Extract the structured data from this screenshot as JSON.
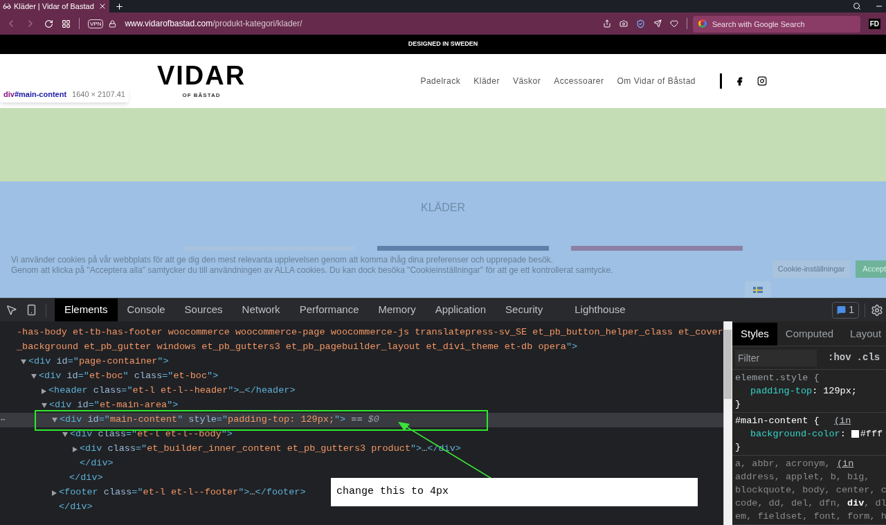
{
  "browser": {
    "tab_title": "Kläder | Vidar of Bastad",
    "vpn_badge": "VPN",
    "url_host": "www.vidarofbastad.com",
    "url_path": "/produkt-kategori/klader/",
    "search": {
      "placeholder": "Search with Google Search"
    },
    "profile": "FD"
  },
  "site": {
    "banner": "DESIGNED IN SWEDEN",
    "logo": "VIDAR",
    "logo_sub": "OF BÅSTAD",
    "nav": [
      {
        "label": "Padelrack"
      },
      {
        "label": "Kläder"
      },
      {
        "label": "Väskor"
      },
      {
        "label": "Accessoarer"
      },
      {
        "label": "Om Vidar of Båstad"
      }
    ],
    "heading": "KLÄDER",
    "card_edges": [
      {
        "color": "#a8c3df"
      },
      {
        "color": "#5e80aa"
      },
      {
        "color": "#8d80a3"
      }
    ],
    "cookie": {
      "text": [
        "Vi använder cookies på vår webbplats för att ge dig den mest relevanta upplevelsen genom att komma ihåg dina preferenser och upprepade besök.",
        "Genom att klicka på \"Acceptera alla\" samtycker du till användningen av ALLA cookies. Du kan dock besöka \"Cookieinställningar\" för att ge ett kontrollerat samtycke."
      ],
      "buttons": [
        {
          "label": "Cookie-inställningar",
          "kind": "secondary"
        },
        {
          "label": "Accept",
          "kind": "primary"
        }
      ]
    }
  },
  "inspect_tooltip": {
    "selector_tag": "div",
    "selector_id": "#main-content",
    "size": "1640 × 2107.41"
  },
  "devtools": {
    "tabs": [
      {
        "label": "Elements",
        "selected": true
      },
      {
        "label": "Console",
        "selected": false
      },
      {
        "label": "Sources",
        "selected": false
      },
      {
        "label": "Network",
        "selected": false
      },
      {
        "label": "Performance",
        "selected": false
      },
      {
        "label": "Memory",
        "selected": false
      },
      {
        "label": "Application",
        "selected": false
      },
      {
        "label": "Security",
        "selected": false
      },
      {
        "label": "Lighthouse",
        "selected": false
      }
    ],
    "issues_count": "1",
    "row_menu": "⋯",
    "dom": [
      {
        "selected": false,
        "tokens": [
          {
            "kind": "val",
            "s": "-has-body et-tb-has-footer woocommerce woocommerce-page woocommerce-js translatepress-sv_SE et_pb_button_helper_class et_cover"
          }
        ]
      },
      {
        "selected": false,
        "tokens": [
          {
            "kind": "val",
            "s": "_background et_pb_gutter windows et_pb_gutters3 et_pb_pagebuilder_layout et_divi_theme et-db opera"
          },
          {
            "kind": "tag",
            "s": "\">"
          }
        ]
      },
      {
        "expanded": true,
        "selected": false,
        "tokens": [
          {
            "kind": "tag",
            "s": "<div"
          },
          {
            "kind": "attr",
            "s": " id"
          },
          {
            "kind": "tag",
            "s": "=\""
          },
          {
            "kind": "val",
            "s": "page-container"
          },
          {
            "kind": "tag",
            "s": "\">"
          }
        ],
        "children": [
          {
            "expanded": true,
            "selected": false,
            "tokens": [
              {
                "kind": "tag",
                "s": "<div"
              },
              {
                "kind": "attr",
                "s": " id"
              },
              {
                "kind": "tag",
                "s": "=\""
              },
              {
                "kind": "val",
                "s": "et-boc"
              },
              {
                "kind": "tag",
                "s": "\""
              },
              {
                "kind": "attr",
                "s": " class"
              },
              {
                "kind": "tag",
                "s": "=\""
              },
              {
                "kind": "val",
                "s": "et-boc"
              },
              {
                "kind": "tag",
                "s": "\">"
              }
            ],
            "children": [
              {
                "expanded": false,
                "selected": false,
                "tokens": [
                  {
                    "kind": "tag",
                    "s": "<header"
                  },
                  {
                    "kind": "attr",
                    "s": " class"
                  },
                  {
                    "kind": "tag",
                    "s": "=\""
                  },
                  {
                    "kind": "val",
                    "s": "et-l et-l--header"
                  },
                  {
                    "kind": "tag",
                    "s": "\">"
                  },
                  {
                    "kind": "text",
                    "s": "…"
                  },
                  {
                    "kind": "tag",
                    "s": "</header>"
                  }
                ]
              },
              {
                "expanded": true,
                "selected": false,
                "tokens": [
                  {
                    "kind": "tag",
                    "s": "<div"
                  },
                  {
                    "kind": "attr",
                    "s": " id"
                  },
                  {
                    "kind": "tag",
                    "s": "=\""
                  },
                  {
                    "kind": "val",
                    "s": "et-main-area"
                  },
                  {
                    "kind": "tag",
                    "s": "\">"
                  }
                ],
                "children": [
                  {
                    "expanded": true,
                    "selected": true,
                    "tokens": [
                      {
                        "kind": "tag",
                        "s": "<div"
                      },
                      {
                        "kind": "attr",
                        "s": " id"
                      },
                      {
                        "kind": "tag",
                        "s": "=\""
                      },
                      {
                        "kind": "val",
                        "s": "main-content"
                      },
                      {
                        "kind": "tag",
                        "s": "\""
                      },
                      {
                        "kind": "attr",
                        "s": " style"
                      },
                      {
                        "kind": "tag",
                        "s": "=\""
                      },
                      {
                        "kind": "val",
                        "s": "padding-top: 129px;"
                      },
                      {
                        "kind": "tag",
                        "s": "\">"
                      },
                      {
                        "kind": "text",
                        "s": " == "
                      },
                      {
                        "kind": "ref",
                        "s": "$0"
                      }
                    ],
                    "children": [
                      {
                        "expanded": true,
                        "selected": false,
                        "tokens": [
                          {
                            "kind": "tag",
                            "s": "<div"
                          },
                          {
                            "kind": "attr",
                            "s": " class"
                          },
                          {
                            "kind": "tag",
                            "s": "=\""
                          },
                          {
                            "kind": "val",
                            "s": "et-l et-l--body"
                          },
                          {
                            "kind": "tag",
                            "s": "\">"
                          }
                        ],
                        "children": [
                          {
                            "expanded": false,
                            "selected": false,
                            "tokens": [
                              {
                                "kind": "tag",
                                "s": "<div"
                              },
                              {
                                "kind": "attr",
                                "s": " class"
                              },
                              {
                                "kind": "tag",
                                "s": "=\""
                              },
                              {
                                "kind": "val",
                                "s": "et_builder_inner_content et_pb_gutters3 product"
                              },
                              {
                                "kind": "tag",
                                "s": "\">"
                              },
                              {
                                "kind": "text",
                                "s": "…"
                              },
                              {
                                "kind": "tag",
                                "s": "</div>"
                              }
                            ]
                          },
                          {
                            "selected": false,
                            "tokens": [
                              {
                                "kind": "tag",
                                "s": "</div>"
                              }
                            ]
                          }
                        ]
                      },
                      {
                        "selected": false,
                        "tokens": [
                          {
                            "kind": "tag",
                            "s": "</div>"
                          }
                        ]
                      }
                    ]
                  },
                  {
                    "expanded": false,
                    "selected": false,
                    "tokens": [
                      {
                        "kind": "tag",
                        "s": "<footer"
                      },
                      {
                        "kind": "attr",
                        "s": " class"
                      },
                      {
                        "kind": "tag",
                        "s": "=\""
                      },
                      {
                        "kind": "val",
                        "s": "et-l et-l--footer"
                      },
                      {
                        "kind": "tag",
                        "s": "\">"
                      },
                      {
                        "kind": "text",
                        "s": "…"
                      },
                      {
                        "kind": "tag",
                        "s": "</footer>"
                      }
                    ]
                  },
                  {
                    "selected": false,
                    "tokens": [
                      {
                        "kind": "tag",
                        "s": "</div>"
                      }
                    ]
                  }
                ]
              }
            ]
          }
        ]
      }
    ],
    "side_tabs": [
      {
        "label": "Styles",
        "selected": true
      },
      {
        "label": "Computed",
        "selected": false
      },
      {
        "label": "Layout",
        "selected": false
      }
    ],
    "filter": {
      "placeholder": "Filter"
    },
    "hov": ":hov",
    "cls": ".cls",
    "rules": [
      {
        "kind": "inline",
        "selector": "element.style {",
        "props": [
          {
            "name": "padding-top",
            "sep": ":",
            "value": "129px;"
          }
        ],
        "close": "}"
      },
      {
        "kind": "rule",
        "selector": "#main-content {",
        "source": "(in",
        "props": [
          {
            "name": "background-color",
            "sep": ":",
            "value": "#fff",
            "color": "#ffffff"
          }
        ],
        "close": "}"
      },
      {
        "kind": "ua",
        "selector_lines": [
          "a, abbr, acronym,",
          "address, applet, b, big,",
          "blockquote, body, center, c",
          "code, dd, del, dfn, **div**, dl",
          "em, fieldset, font, form, h"
        ],
        "source": "(in"
      }
    ]
  },
  "annotation": {
    "note": "change this to 4px"
  }
}
